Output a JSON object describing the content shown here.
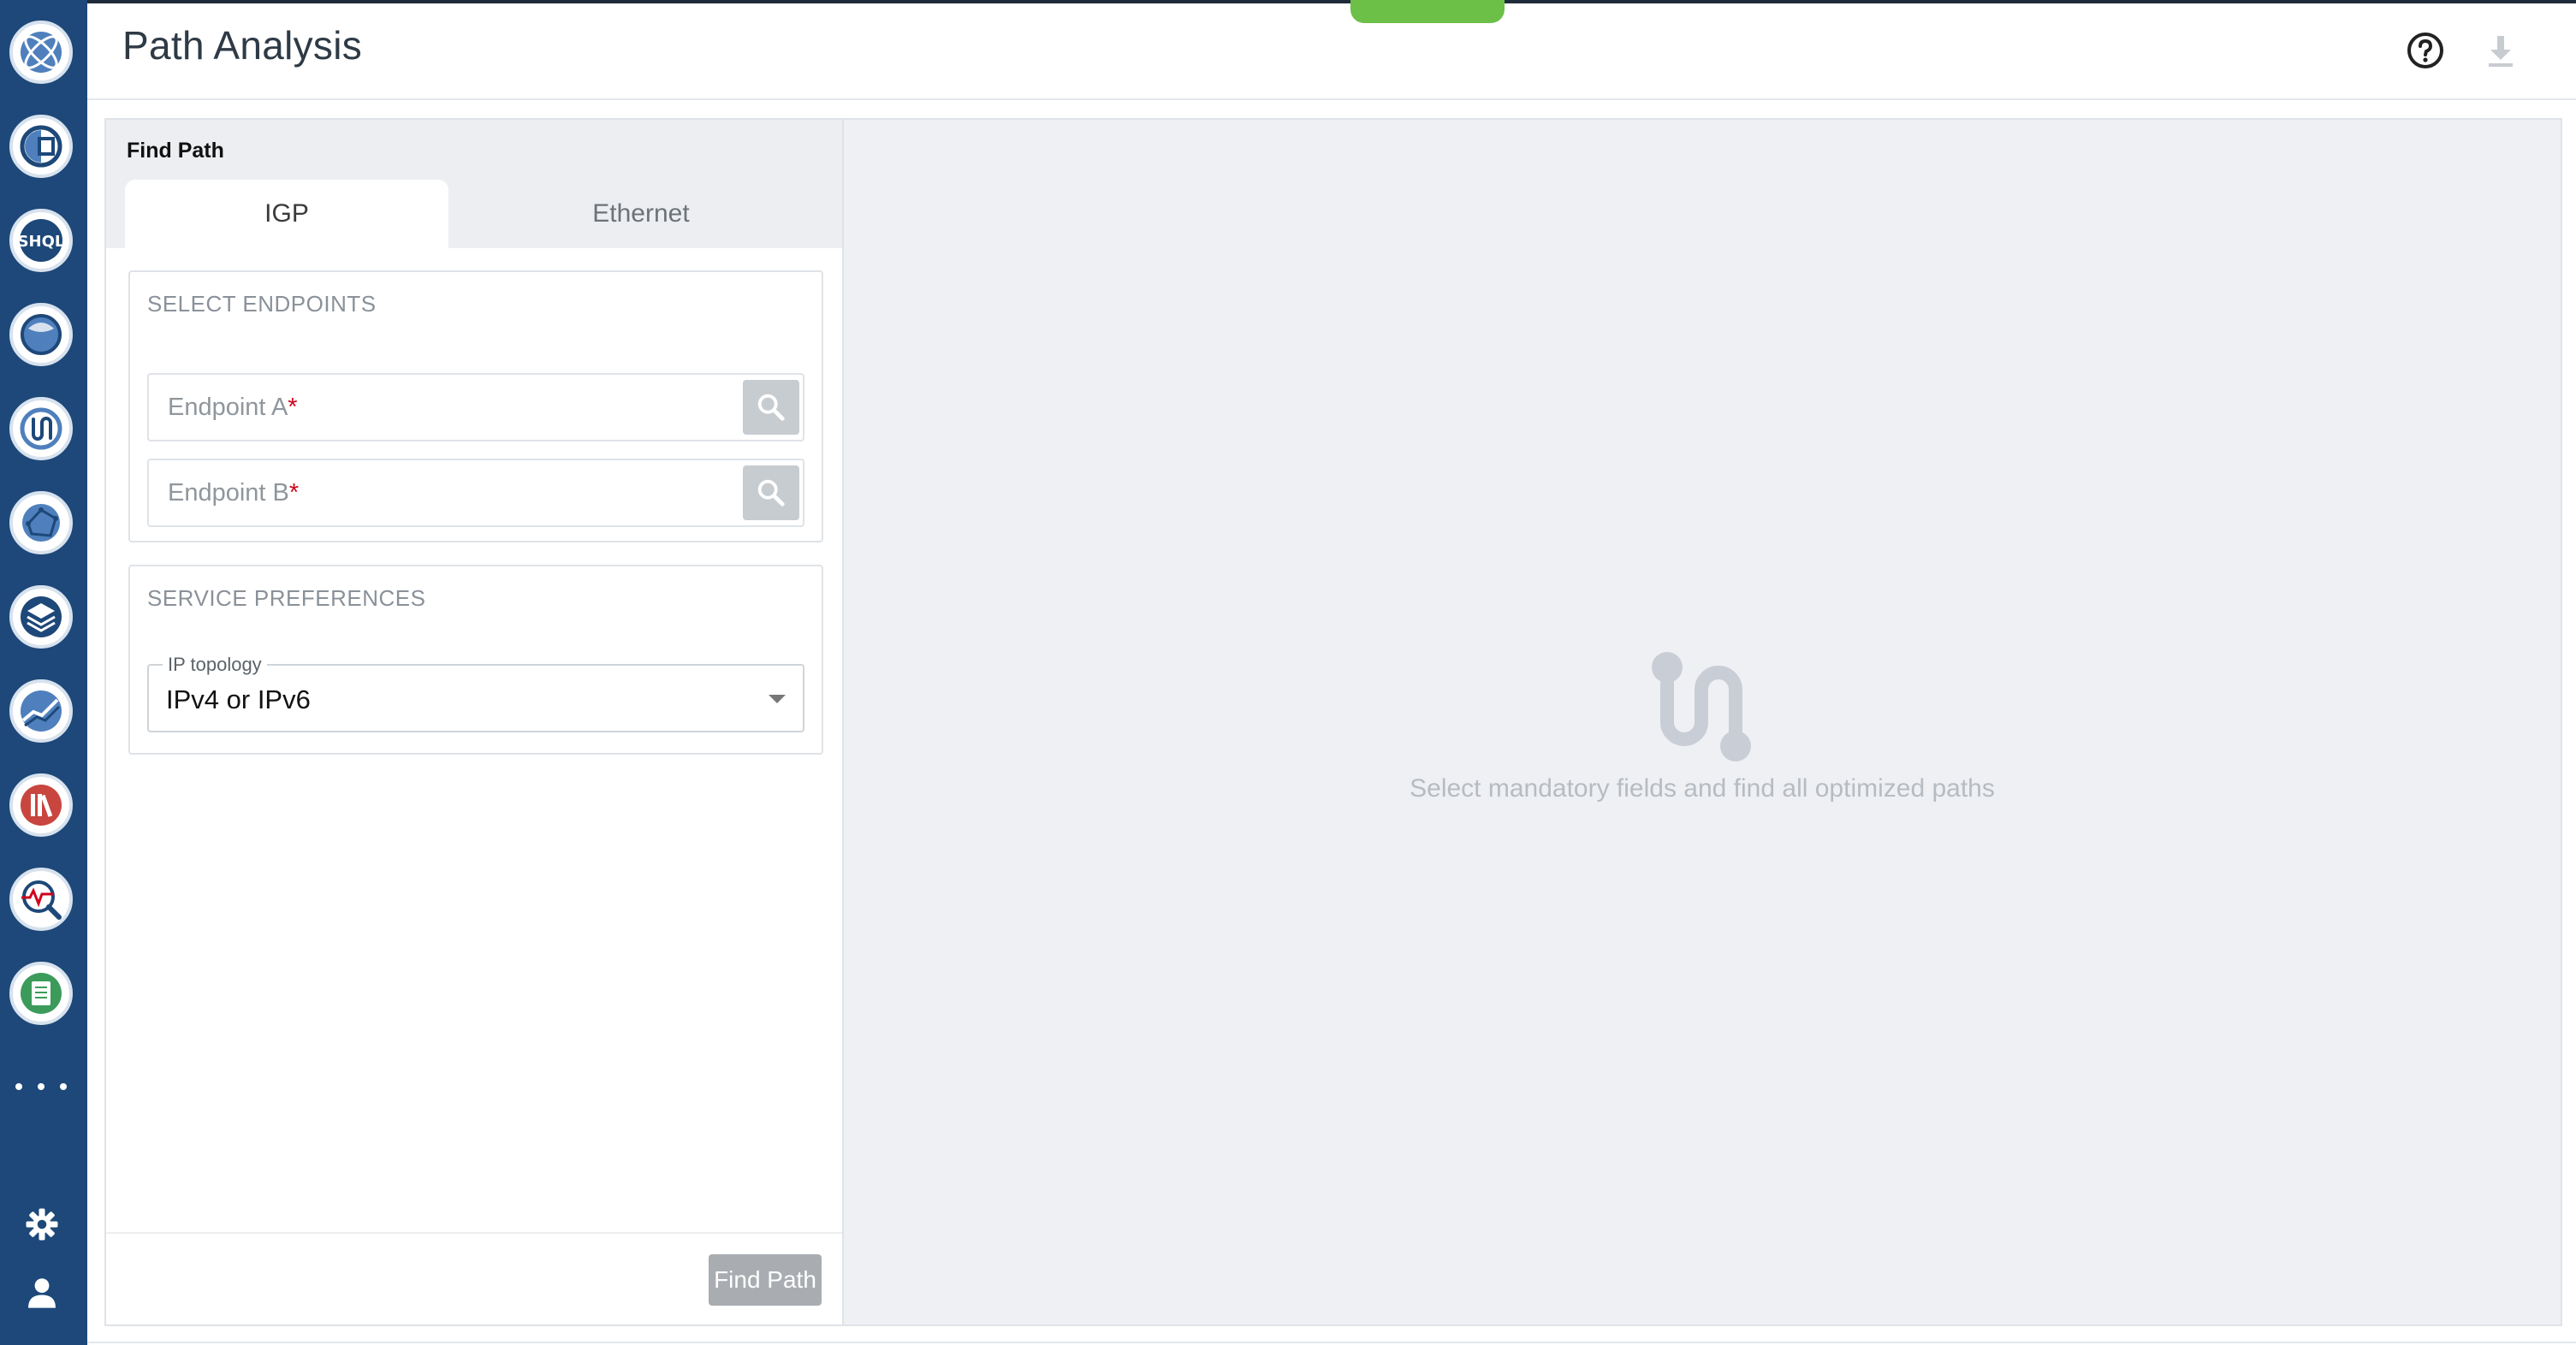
{
  "app": {
    "title": "Path Analysis"
  },
  "sidebar": {
    "items": [
      {
        "name": "logo-globe-icon"
      },
      {
        "name": "dashboard-gauge-icon"
      },
      {
        "name": "shql-icon",
        "label": "SHQL"
      },
      {
        "name": "globe-map-icon"
      },
      {
        "name": "path-analysis-icon"
      },
      {
        "name": "network-topology-icon"
      },
      {
        "name": "layers-icon"
      },
      {
        "name": "trend-chart-icon"
      },
      {
        "name": "library-books-icon"
      },
      {
        "name": "monitor-search-icon"
      },
      {
        "name": "document-icon"
      }
    ],
    "more_icon": "more-dots-icon",
    "settings_icon": "gear-icon",
    "user_icon": "user-icon"
  },
  "header": {
    "help_icon": "help-circle-icon",
    "download_icon": "download-icon"
  },
  "find_path": {
    "title": "Find Path",
    "tabs": [
      {
        "label": "IGP",
        "active": true
      },
      {
        "label": "Ethernet",
        "active": false
      }
    ],
    "endpoints": {
      "section_title": "SELECT ENDPOINTS",
      "endpoint_a_placeholder": "Endpoint A",
      "endpoint_b_placeholder": "Endpoint B",
      "required_marker": "*"
    },
    "service_preferences": {
      "section_title": "SERVICE PREFERENCES",
      "ip_topology_label": "IP topology",
      "ip_topology_value": "IPv4 or IPv6"
    },
    "find_button": "Find Path"
  },
  "results": {
    "empty_message": "Select mandatory fields and find all optimized paths",
    "empty_icon": "route-path-icon"
  },
  "colors": {
    "sidebar_bg": "#1d4879",
    "accent_green": "#6cbf47",
    "required_red": "#d0021b",
    "panel_bg": "#eef0f4"
  }
}
